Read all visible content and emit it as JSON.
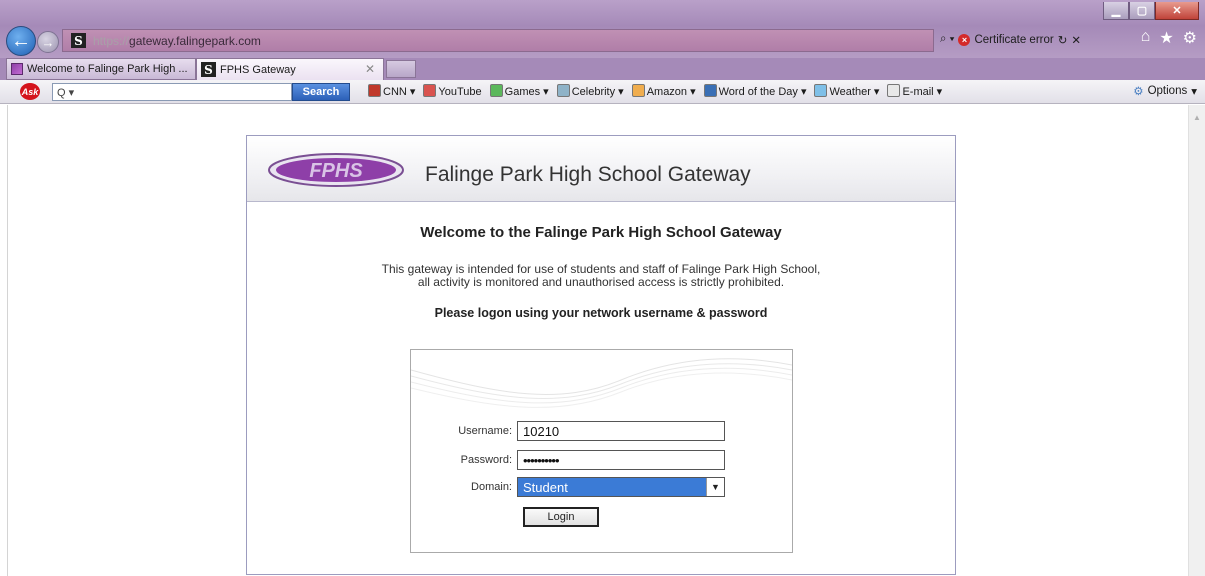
{
  "browser": {
    "url_protocol": "https://",
    "url_host": "gateway.falingepark.com",
    "search_glyph": "⌕ ▾",
    "certificate_error": "Certificate error",
    "tabs": [
      {
        "label": "Welcome to Falinge Park High ..."
      },
      {
        "label": "FPHS Gateway"
      }
    ]
  },
  "ask_toolbar": {
    "logo_text": "Ask",
    "search_placeholder": "Q ▾",
    "search_button": "Search",
    "links": [
      {
        "label": "CNN ▾",
        "icon": "cnn-icon"
      },
      {
        "label": "YouTube",
        "icon": "youtube-icon"
      },
      {
        "label": "Games ▾",
        "icon": "games-icon"
      },
      {
        "label": "Celebrity ▾",
        "icon": "celebrity-icon"
      },
      {
        "label": "Amazon ▾",
        "icon": "amazon-icon"
      },
      {
        "label": "Word of the Day ▾",
        "icon": "word-icon"
      },
      {
        "label": "Weather ▾",
        "icon": "weather-icon"
      },
      {
        "label": "E-mail ▾",
        "icon": "email-icon"
      }
    ],
    "options": "Options"
  },
  "page": {
    "logo_text": "FPHS",
    "title": "Falinge Park High School Gateway",
    "welcome": "Welcome to the Falinge Park High School Gateway",
    "description_line1": "This gateway is intended for use of students and staff of Falinge Park High School,",
    "description_line2": "all activity is monitored and unauthorised access is strictly prohibited.",
    "prompt": "Please logon using your network username & password"
  },
  "login_form": {
    "username_label": "Username:",
    "username_value": "10210",
    "password_label": "Password:",
    "password_value": "••••••••••",
    "domain_label": "Domain:",
    "domain_value": "Student",
    "login_button": "Login"
  },
  "colors": {
    "chrome": "#a58ab8",
    "accent": "#3b7bd6",
    "logo_purple": "#8e3fa8"
  }
}
